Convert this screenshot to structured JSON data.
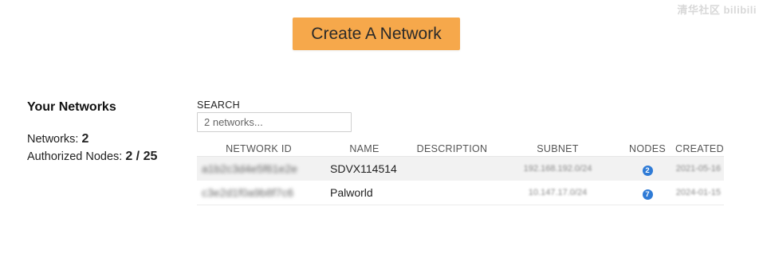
{
  "watermark": "清华社区 bilibili",
  "header": {
    "create_button_label": "Create A Network"
  },
  "summary": {
    "title": "Your Networks",
    "networks_label": "Networks:",
    "networks_count": "2",
    "authorized_label": "Authorized Nodes:",
    "authorized_value": "2 / 25"
  },
  "search": {
    "label": "SEARCH",
    "placeholder": "2 networks..."
  },
  "table": {
    "columns": [
      "NETWORK ID",
      "NAME",
      "DESCRIPTION",
      "SUBNET",
      "NODES",
      "CREATED"
    ],
    "rows": [
      {
        "network_id": "a1b2c3d4e5f61e2e",
        "name": "SDVX114514",
        "description": "",
        "subnet": "192.168.192.0/24",
        "nodes": "2",
        "created": "2021-05-16"
      },
      {
        "network_id": "c3e2d1f0a9b8f7c6",
        "name": "Palworld",
        "description": "",
        "subnet": "10.147.17.0/24",
        "nodes": "7",
        "created": "2024-01-15"
      }
    ]
  },
  "colors": {
    "accent": "#f6a84b",
    "badge": "#2f7bd6",
    "row_alt": "#f2f2f2"
  }
}
